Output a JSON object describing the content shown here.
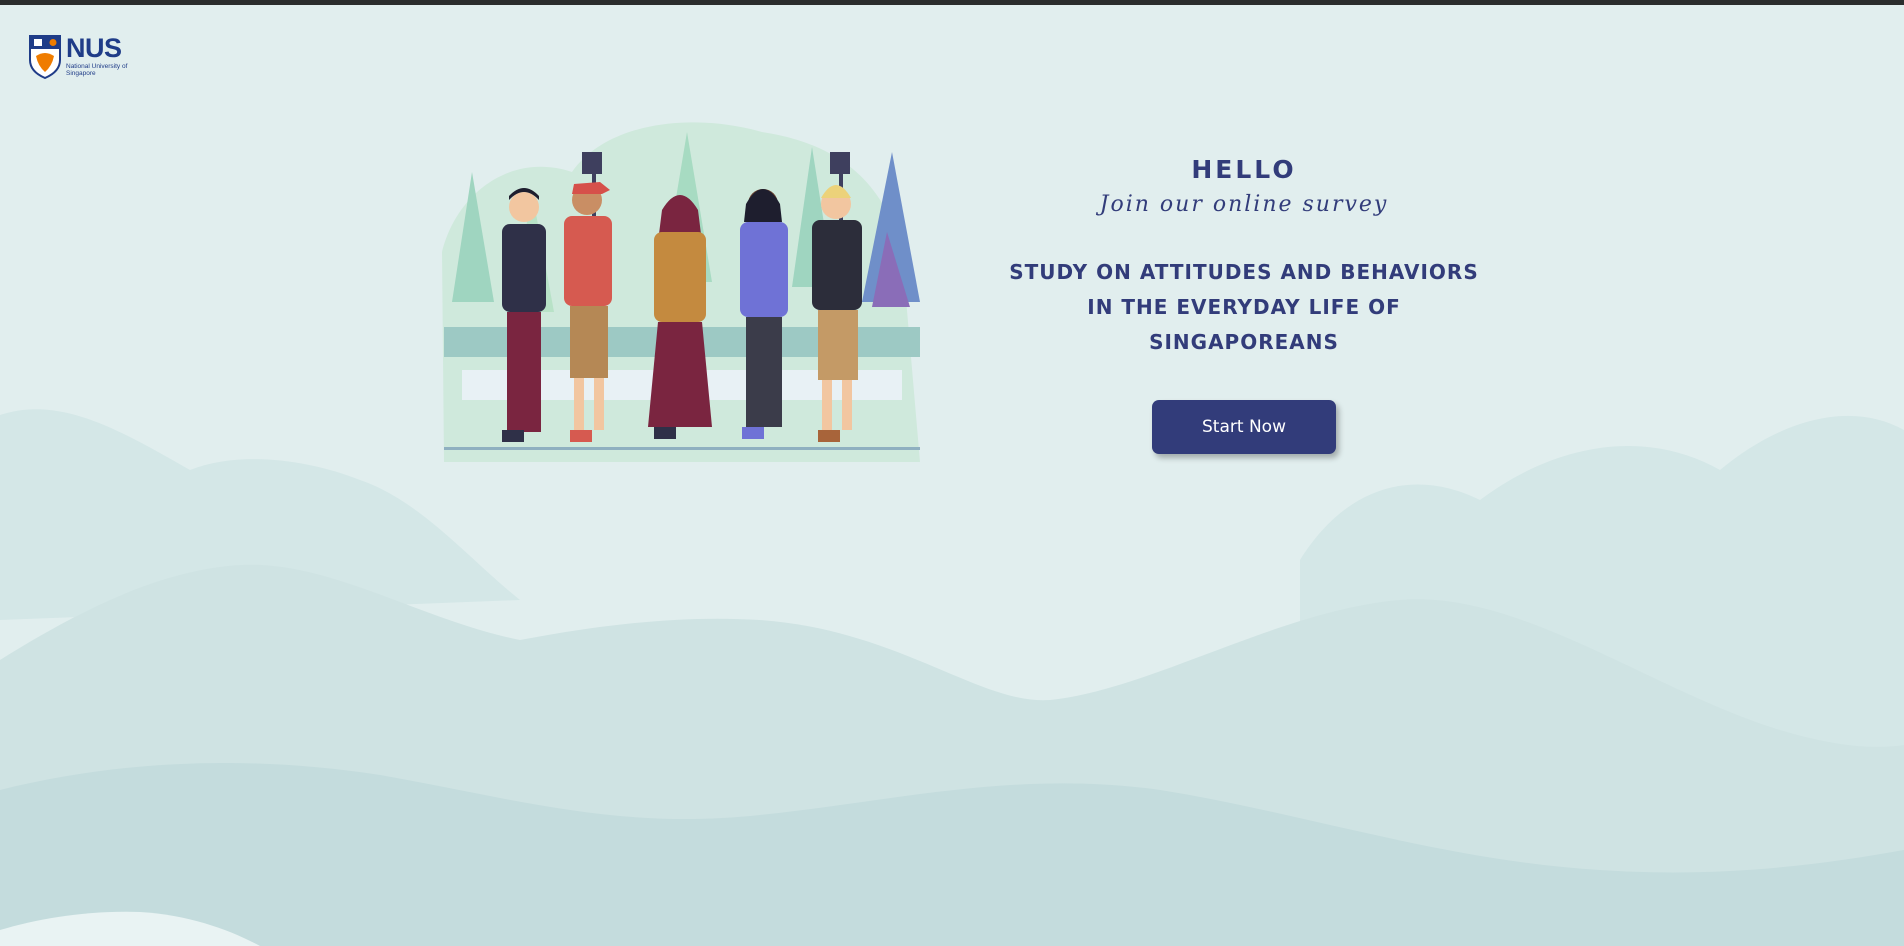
{
  "logo": {
    "abbr": "NUS",
    "full_name": "National University of Singapore"
  },
  "hero": {
    "greeting": "HELLO",
    "subtitle": "Join our online survey",
    "study_title": "STUDY ON ATTITUDES AND BEHAVIORS IN THE EVERYDAY LIFE OF SINGAPOREANS",
    "start_button": "Start Now"
  },
  "colors": {
    "background": "#e1eeee",
    "accent": "#323c7a",
    "logo_blue": "#1f3c88",
    "logo_orange": "#ef7c00"
  },
  "icons": {
    "logo": "nus-crest-icon",
    "illustration": "group-of-people-illustration"
  }
}
